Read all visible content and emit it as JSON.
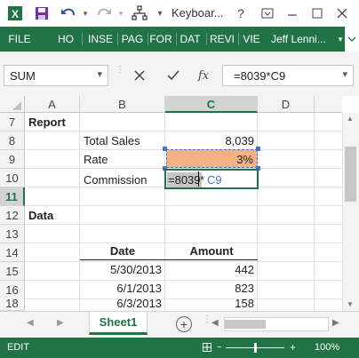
{
  "colors": {
    "accent": "#217346",
    "rate_fill": "#f4b183",
    "formula_ref": "#4472c4"
  },
  "titlebar": {
    "title": "Keyboar...",
    "help": "?",
    "icons": [
      "excel-logo-icon",
      "save-icon",
      "undo-icon",
      "undo-dropdown-icon",
      "redo-icon",
      "redo-dropdown-icon",
      "tree-icon",
      "customize-qat-icon",
      "help-icon",
      "restore-icon",
      "minimize-icon",
      "maximize-icon",
      "close-icon"
    ]
  },
  "ribbon": {
    "file": "FILE",
    "tabs": [
      "HO",
      "INSE",
      "PAG",
      "FOR",
      "DAT",
      "REVI",
      "VIE"
    ],
    "user": "Jeff Lenni..."
  },
  "formula_bar": {
    "name_box": "SUM",
    "fx": "fx",
    "formula": "=8039*C9"
  },
  "columns": [
    "A",
    "B",
    "C",
    "D"
  ],
  "rows": [
    "7",
    "8",
    "9",
    "10",
    "11",
    "12",
    "13",
    "14",
    "15",
    "16",
    "17",
    "18"
  ],
  "cells": {
    "a7": "Report",
    "b8": "Total Sales",
    "c8": "8,039",
    "b9": "Rate",
    "c9": "3%",
    "b11": "Commission",
    "c11_num": "=8039",
    "c11_op": "*",
    "c11_ref": "C9",
    "a13": "Data",
    "b15": "Date",
    "c15": "Amount",
    "b16": "5/30/2013",
    "c16": "442",
    "b17": "6/1/2013",
    "c17": "823",
    "b18": "6/3/2013",
    "c18": "158"
  },
  "sheet_tabs": {
    "active": "Sheet1"
  },
  "status": {
    "mode": "EDIT",
    "zoom": "100%"
  }
}
